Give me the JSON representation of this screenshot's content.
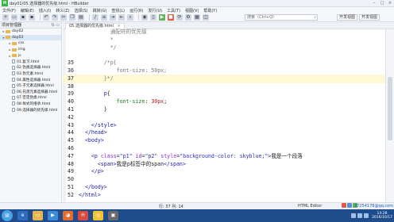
{
  "window": {
    "title": "day01/05.选择器的优先级.html - HBuilder",
    "controls": [
      "–",
      "□",
      "×"
    ]
  },
  "menu": [
    "文件(F)",
    "编辑(E)",
    "插入(I)",
    "转义(Z)",
    "选择(S)",
    "跳转(G)",
    "查找(L)",
    "运行(R)",
    "发行(U)",
    "工具(T)",
    "视图(V)",
    "帮助(Y)"
  ],
  "toolbar": {
    "search_placeholder": "搜索（Ctrl+Q）",
    "view_buttons": [
      "开发视图",
      "开发视图"
    ]
  },
  "sidebar": {
    "title": "项目管理器",
    "items": [
      {
        "label": "day02",
        "type": "folder",
        "indent": 0,
        "expanded": false,
        "selected": false
      },
      {
        "label": "day03",
        "type": "folder",
        "indent": 0,
        "expanded": true,
        "selected": true
      },
      {
        "label": "css",
        "type": "folder",
        "indent": 1,
        "expanded": false,
        "selected": false
      },
      {
        "label": "img",
        "type": "folder",
        "indent": 1,
        "expanded": false,
        "selected": false
      },
      {
        "label": "js",
        "type": "folder",
        "indent": 1,
        "expanded": false,
        "selected": false
      },
      {
        "label": "01.复习.html",
        "type": "file",
        "indent": 1,
        "selected": false
      },
      {
        "label": "02.伪类选择器.html",
        "type": "file",
        "indent": 1,
        "selected": false
      },
      {
        "label": "03.伪元素.html",
        "type": "file",
        "indent": 1,
        "selected": false
      },
      {
        "label": "04.属性选择器.html",
        "type": "file",
        "indent": 1,
        "selected": false
      },
      {
        "label": "05.子元素选择器.html",
        "type": "file",
        "indent": 1,
        "selected": false
      },
      {
        "label": "06.兄弟元素选择器.html",
        "type": "file",
        "indent": 1,
        "selected": false
      },
      {
        "label": "07.否定伪类.html",
        "type": "file",
        "indent": 1,
        "selected": false
      },
      {
        "label": "08.样式的继承.html",
        "type": "file",
        "indent": 1,
        "selected": false
      },
      {
        "label": "09.选择器的优先级.html",
        "type": "file",
        "indent": 1,
        "selected": false
      }
    ]
  },
  "editor_tab": {
    "label": "05.选择器的优先级.html",
    "close": "×"
  },
  "code_lines": [
    {
      "n": "",
      "html": "          <span class='cmt'>通配符的优先级</span>"
    },
    {
      "n": "",
      "html": "          <span class='cmt'>*</span>"
    },
    {
      "n": "",
      "html": "          <span class='cmt'>*/</span>"
    },
    {
      "n": "",
      "html": ""
    },
    {
      "n": "35",
      "html": "        <span class='cmt'>/*p{</span>"
    },
    {
      "n": "36",
      "html": "            <span class='cmt'>font-size: 50px;</span>"
    },
    {
      "n": "37",
      "html": "        <span class='cmt'>}*/</span>",
      "cur": true
    },
    {
      "n": "38",
      "html": ""
    },
    {
      "n": "39",
      "html": "        <span class='tag'>p</span>{"
    },
    {
      "n": "40",
      "html": "            <span class='prop'>font-size</span>: <span class='num'>30px</span>;"
    },
    {
      "n": "41",
      "html": "        }"
    },
    {
      "n": "42",
      "html": ""
    },
    {
      "n": "43",
      "html": "    <span class='tag'>&lt;/style&gt;</span>"
    },
    {
      "n": "44",
      "html": "  <span class='tag'>&lt;/head&gt;</span>"
    },
    {
      "n": "45",
      "html": "  <span class='tag'>&lt;body&gt;</span>"
    },
    {
      "n": "46",
      "html": ""
    },
    {
      "n": "47",
      "html": "    <span class='tag'>&lt;p</span> <span class='attr'>class</span>=<span class='str'>\"p1\"</span> <span class='attr'>id</span>=<span class='str'>\"p2\"</span> <span class='attr'>style</span>=<span class='str'>\"background-color: skyblue;\"</span><span class='tag'>&gt;</span>我是一个段落"
    },
    {
      "n": "48",
      "html": "      <span class='tag'>&lt;span&gt;</span>我是p标签中的span<span class='tag'>&lt;/span&gt;</span>"
    },
    {
      "n": "49",
      "html": "    <span class='tag'>&lt;/p&gt;</span>"
    },
    {
      "n": "50",
      "html": ""
    },
    {
      "n": "51",
      "html": "  <span class='tag'>&lt;/body&gt;</span>"
    },
    {
      "n": "52",
      "html": "<span class='tag'>&lt;/html&gt;</span>"
    }
  ],
  "status": {
    "cursor": "行: 37 列: 14",
    "syntax": "HTML Editor",
    "user": "37254178@qq.com"
  },
  "taskbar": {
    "clock_time": "14:28",
    "clock_date": "2016/10/17"
  }
}
